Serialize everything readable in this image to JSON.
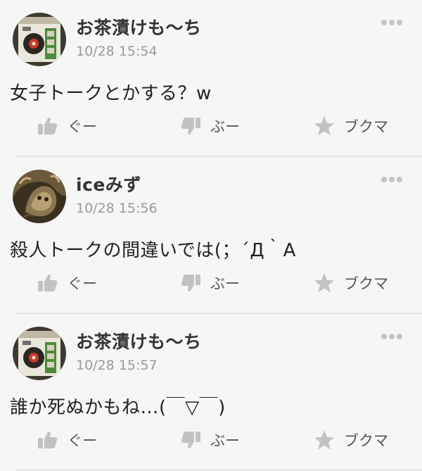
{
  "posts": [
    {
      "username": "お茶漬けも〜ち",
      "timestamp": "10/28 15:54",
      "text": "女子トークとかする？w",
      "avatar": "ochazuke-avatar"
    },
    {
      "username": "iceみず",
      "timestamp": "10/28 15:56",
      "text": "殺人トークの間違いでは(；´Д｀A",
      "avatar": "dragon-avatar"
    },
    {
      "username": "お茶漬けも〜ち",
      "timestamp": "10/28 15:57",
      "text": "誰か死ぬかもね…(￣▽￣)",
      "avatar": "ochazuke-avatar"
    }
  ],
  "actions": {
    "good_label": "ぐー",
    "bad_label": "ぶー",
    "bookmark_label": "ブクマ"
  },
  "icons": {
    "good": "thumbs-up-icon",
    "bad": "thumbs-down-icon",
    "bookmark": "star-icon",
    "more": "more-dots-icon"
  },
  "colors": {
    "background": "#f6f6f6",
    "divider": "#e4e4e4",
    "icon": "#c2c2c2",
    "timestamp": "#9a9a9a"
  }
}
